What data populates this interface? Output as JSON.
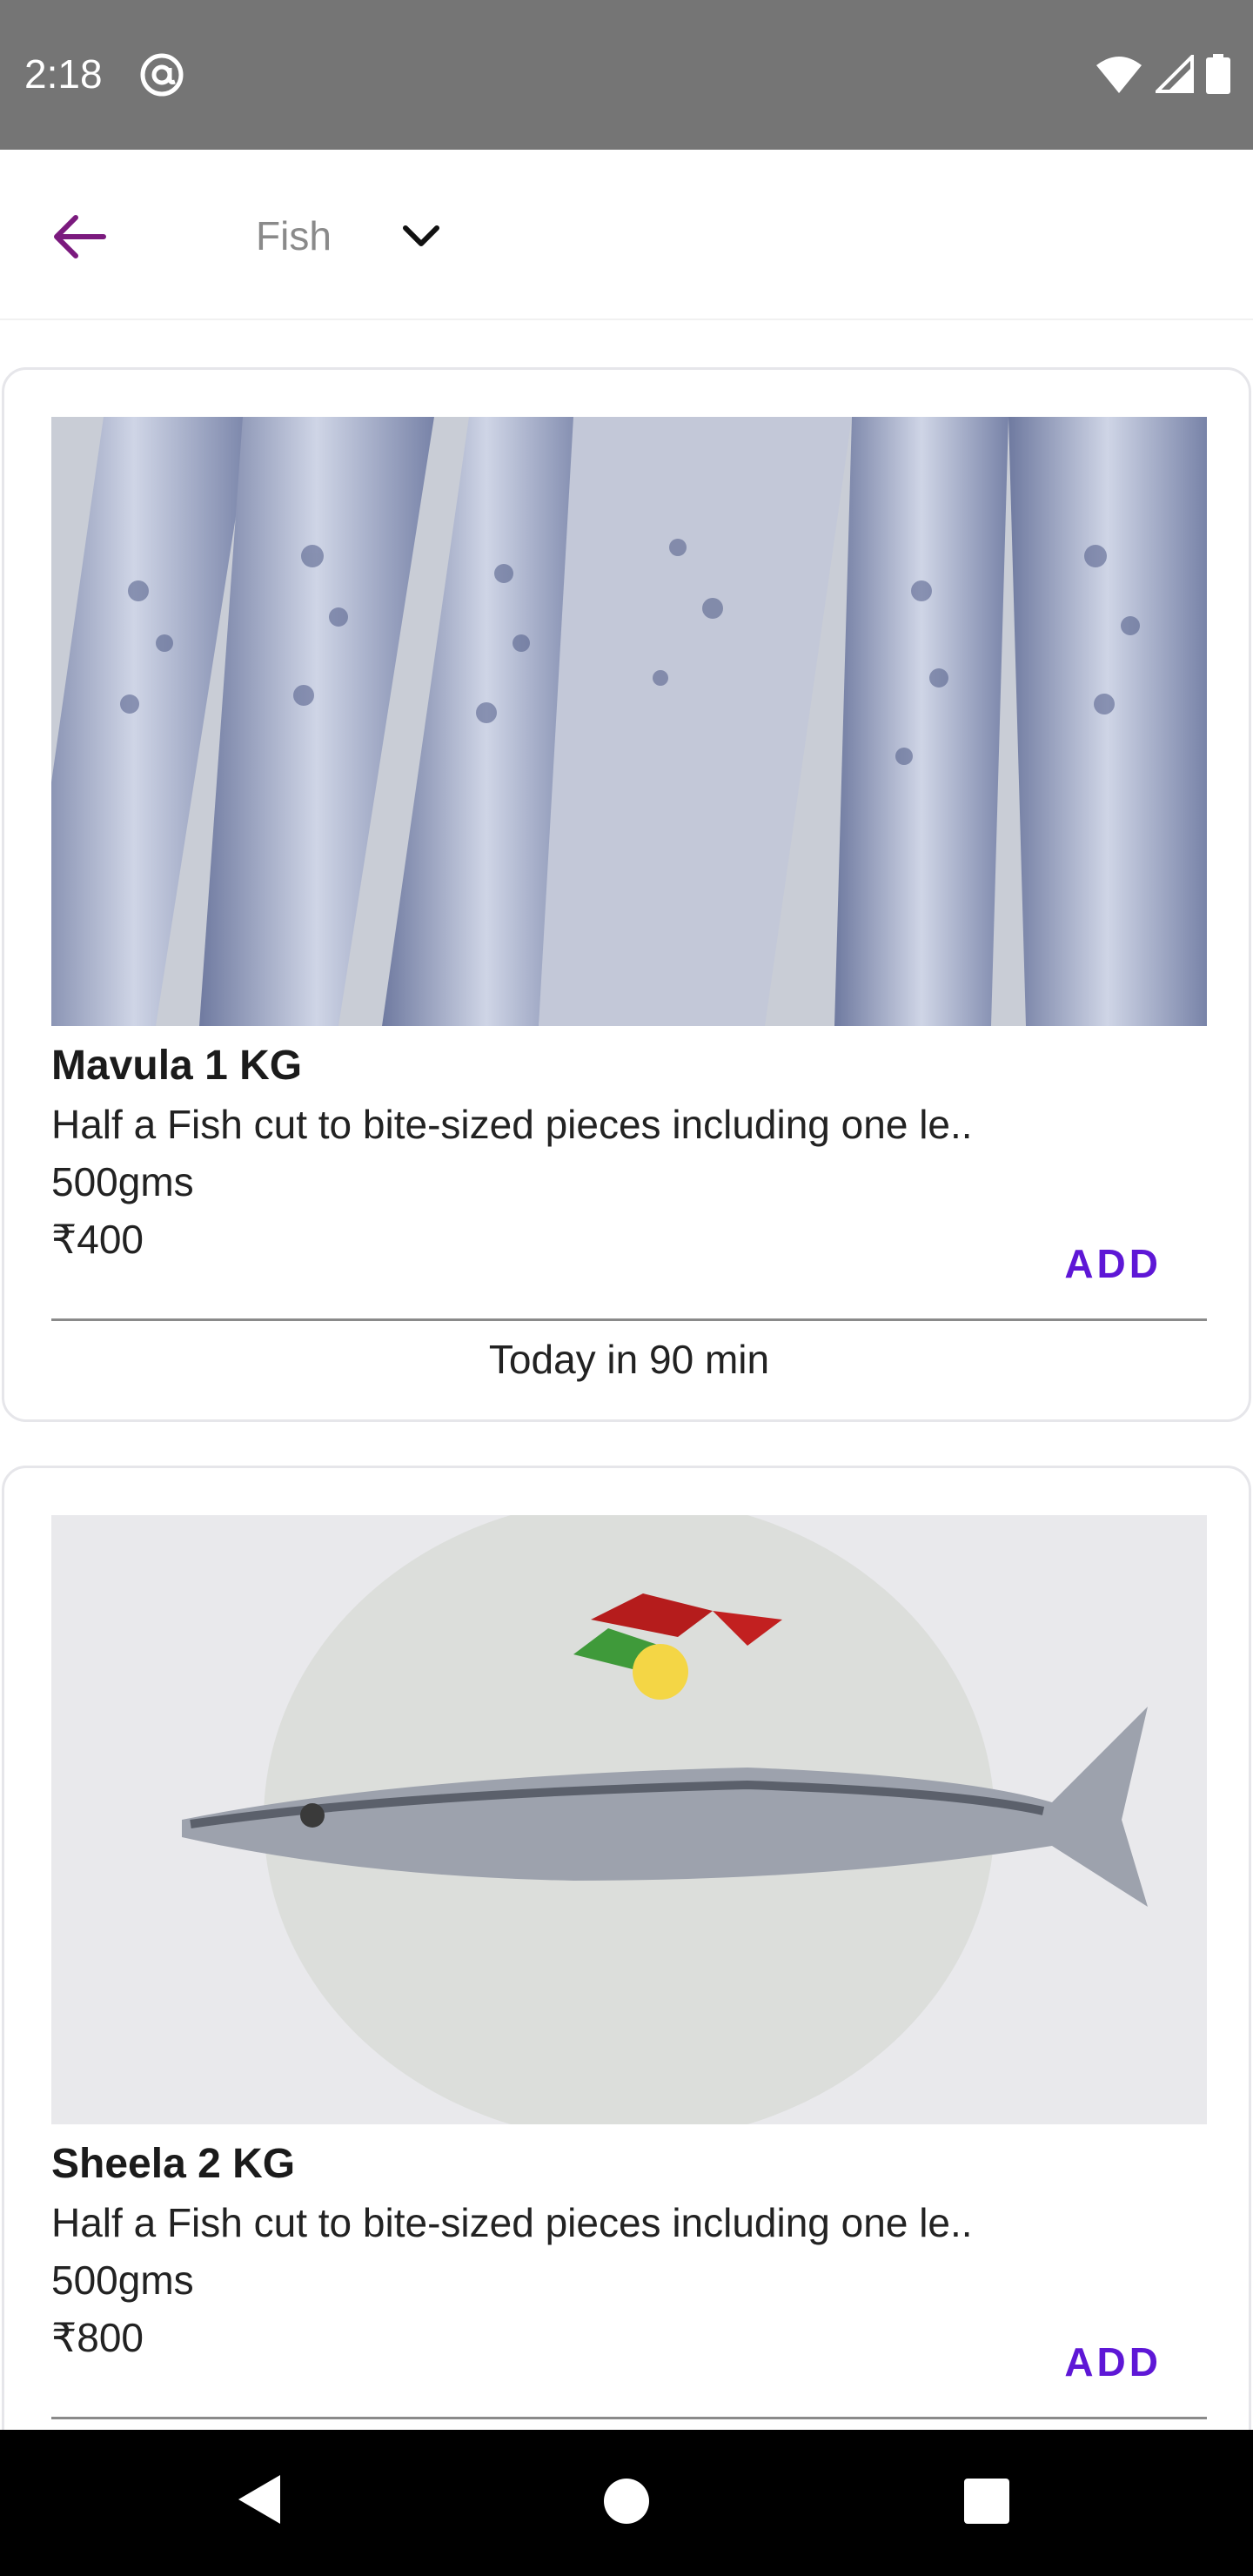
{
  "status_bar": {
    "time": "2:18",
    "icons": [
      "at-sign-icon",
      "wifi-icon",
      "signal-icon",
      "battery-icon"
    ]
  },
  "app_bar": {
    "category": "Fish",
    "back_icon": "arrow-left-icon",
    "dropdown_icon": "chevron-down-icon",
    "accent_color": "#7B1A7E"
  },
  "products": [
    {
      "name": "Mavula 1 KG",
      "description": "Half a Fish cut to bite-sized pieces including one le..",
      "weight": "500gms",
      "price": "₹400",
      "add_label": "ADD",
      "delivery": "Today in 90 min"
    },
    {
      "name": "Sheela 2 KG",
      "description": "Half a Fish cut to bite-sized pieces including one le..",
      "weight": "500gms",
      "price": "₹800",
      "add_label": "ADD",
      "delivery": ""
    }
  ],
  "colors": {
    "add_button": "#5E17D6",
    "status_bar": "#757575",
    "nav_bar": "#000000"
  },
  "nav_bar": {
    "icons": [
      "nav-back-icon",
      "nav-home-icon",
      "nav-recents-icon"
    ]
  }
}
